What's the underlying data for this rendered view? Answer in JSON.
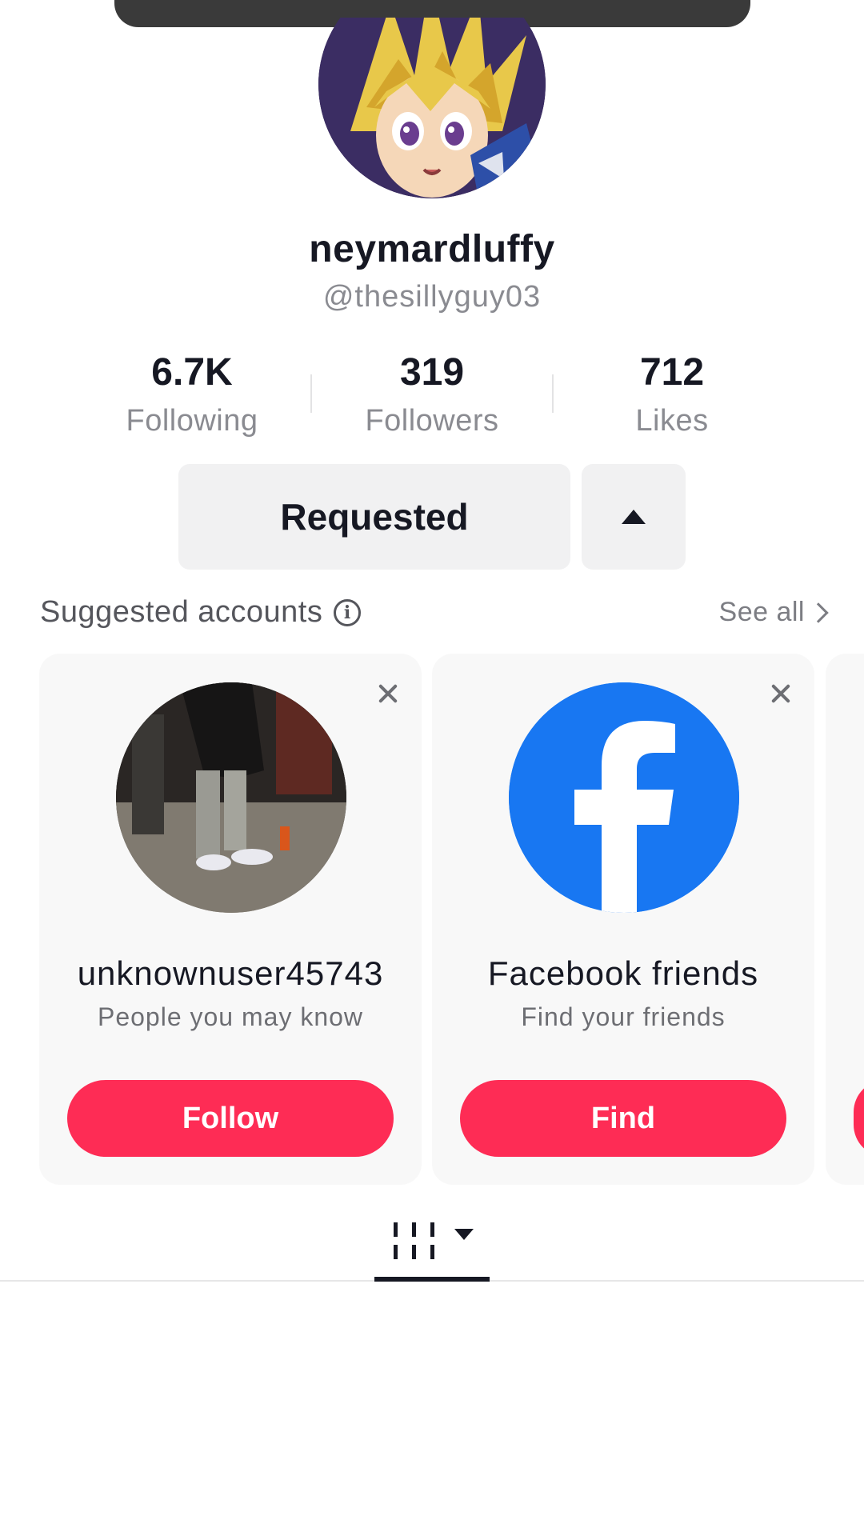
{
  "profile": {
    "display_name": "neymardluffy",
    "handle": "@thesillyguy03"
  },
  "stats": [
    {
      "value": "6.7K",
      "label": "Following"
    },
    {
      "value": "319",
      "label": "Followers"
    },
    {
      "value": "712",
      "label": "Likes"
    }
  ],
  "actions": {
    "requested_label": "Requested"
  },
  "suggested": {
    "title": "Suggested accounts",
    "see_all": "See all",
    "cards": [
      {
        "name": "unknownuser45743",
        "subtitle": "People you may know",
        "button": "Follow"
      },
      {
        "name": "Facebook friends",
        "subtitle": "Find your friends",
        "button": "Find"
      }
    ]
  },
  "colors": {
    "accent": "#fe2c55",
    "facebook": "#1877f2",
    "button_bg": "#f1f1f2"
  }
}
